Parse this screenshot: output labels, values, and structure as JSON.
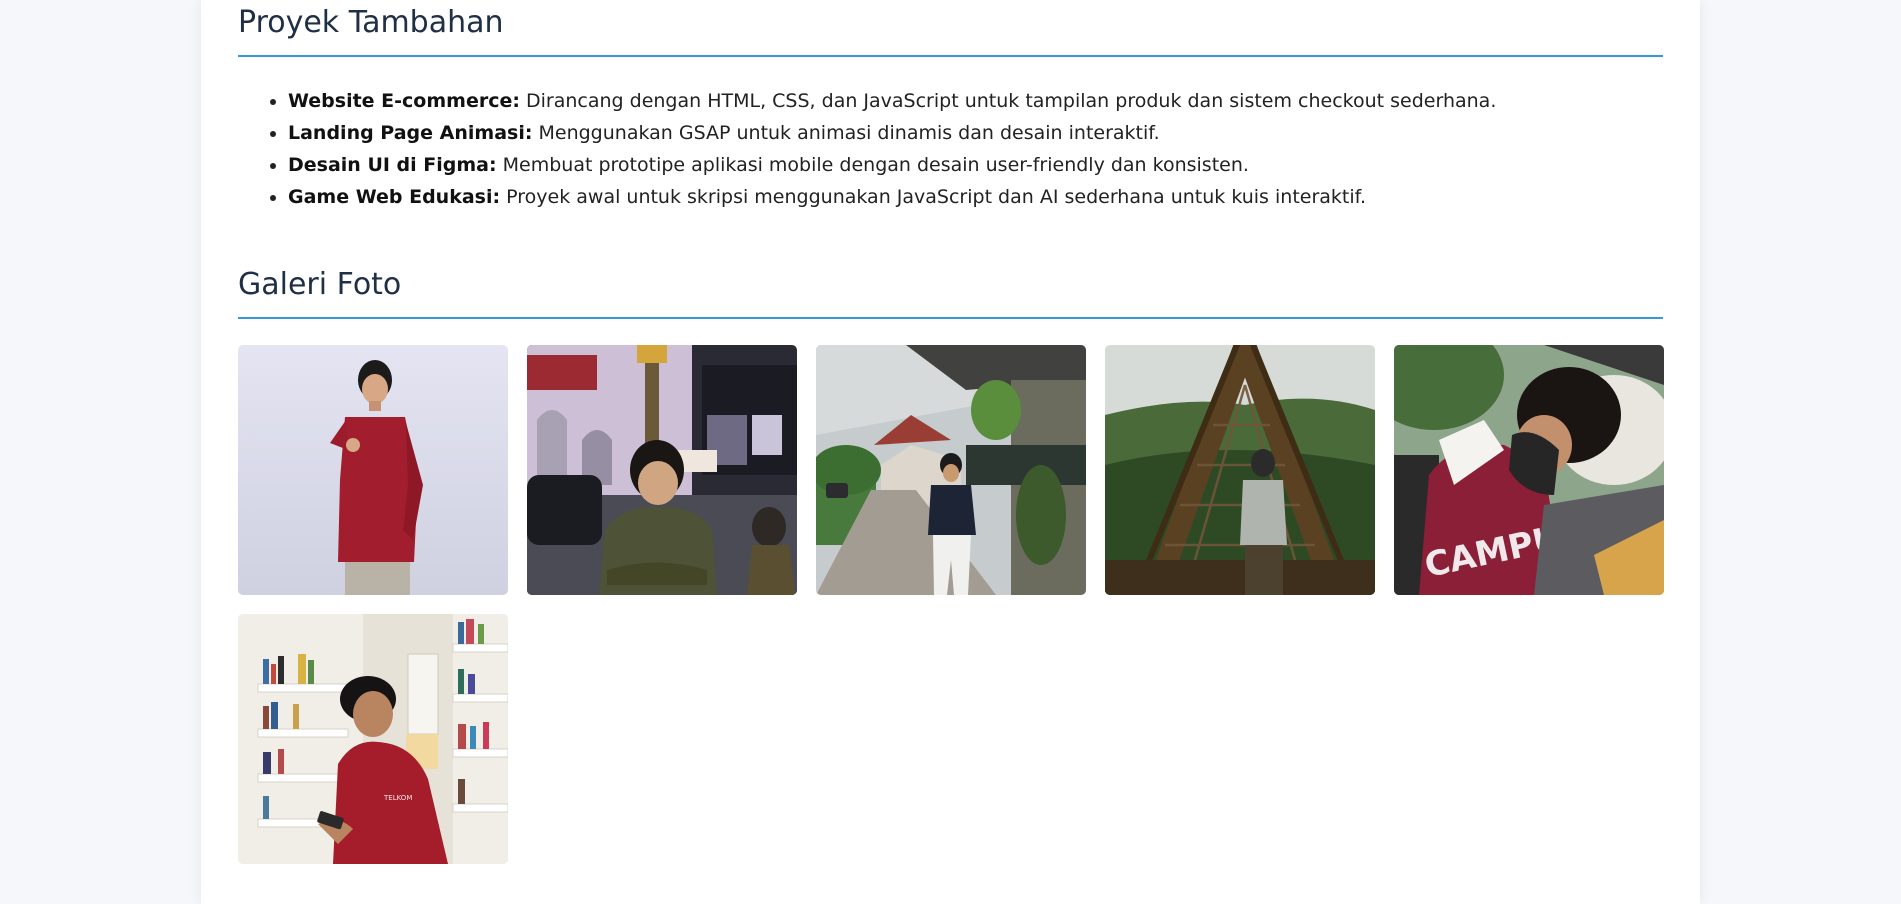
{
  "projects": {
    "title": "Proyek Tambahan",
    "items": [
      {
        "name": "Website E-commerce:",
        "desc": "Dirancang dengan HTML, CSS, dan JavaScript untuk tampilan produk dan sistem checkout sederhana."
      },
      {
        "name": "Landing Page Animasi:",
        "desc": "Menggunakan GSAP untuk animasi dinamis dan desain interaktif."
      },
      {
        "name": "Desain UI di Figma:",
        "desc": "Membuat prototipe aplikasi mobile dengan desain user-friendly dan konsisten."
      },
      {
        "name": "Game Web Edukasi:",
        "desc": "Proyek awal untuk skripsi menggunakan JavaScript dan AI sederhana untuk kuis interaktif."
      }
    ]
  },
  "gallery": {
    "title": "Galeri Foto",
    "photos": [
      {
        "subject": "portrait-red-shirt-pointing"
      },
      {
        "subject": "night-street-green-sweater"
      },
      {
        "subject": "street-navy-shirt"
      },
      {
        "subject": "bamboo-arch-forest"
      },
      {
        "subject": "campus-maroon-sweater-mask"
      },
      {
        "subject": "library-red-jacket-phone"
      }
    ]
  },
  "colors": {
    "accent": "#3498db",
    "heading": "#1f2f45",
    "page_bg": "#f6f7fa"
  }
}
